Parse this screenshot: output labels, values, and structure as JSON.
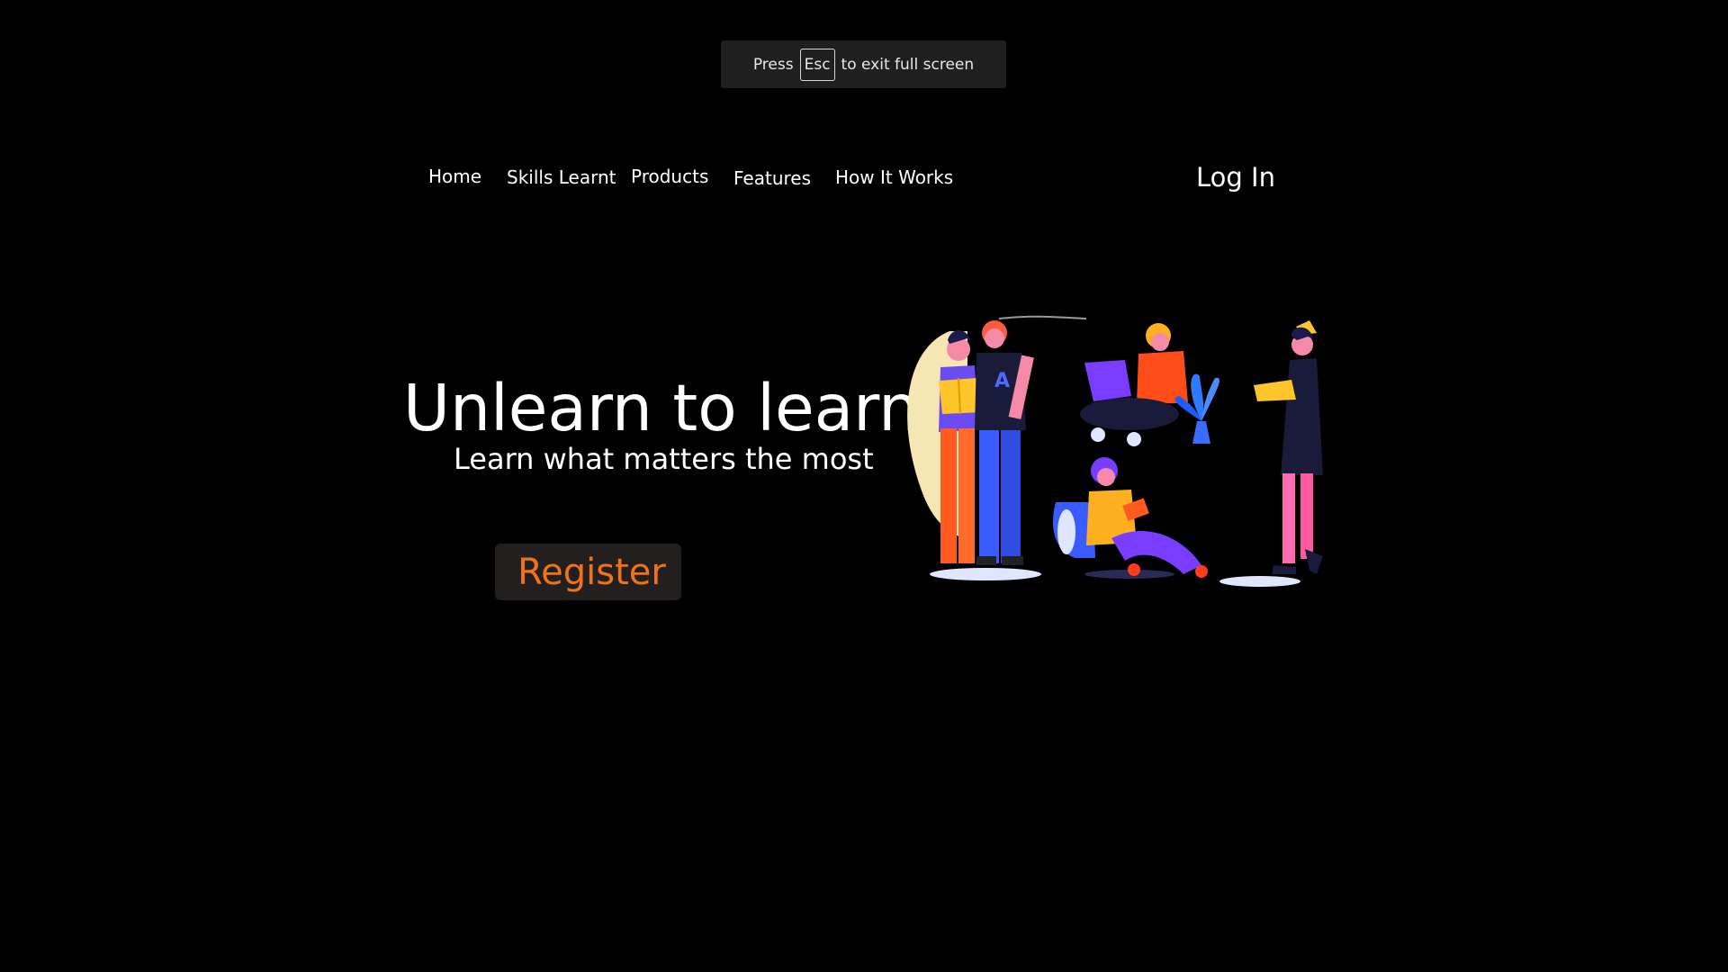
{
  "fullscreen_notice": {
    "press": "Press",
    "key": "Esc",
    "suffix": "to exit full screen"
  },
  "nav": {
    "items": [
      {
        "label": "Home"
      },
      {
        "label": "Skills Learnt"
      },
      {
        "label": "Products"
      },
      {
        "label": "Features"
      },
      {
        "label": "How It Works"
      }
    ],
    "login": "Log In"
  },
  "hero": {
    "title": "Unlearn to learn",
    "subtitle": "Learn what matters the most",
    "register": "Register"
  },
  "colors": {
    "background": "#000000",
    "accent": "#f07318",
    "button_bg": "#221f1e",
    "notice_bg": "#1f1f1f"
  },
  "illustration": {
    "icon": "people-reading-illustration"
  }
}
